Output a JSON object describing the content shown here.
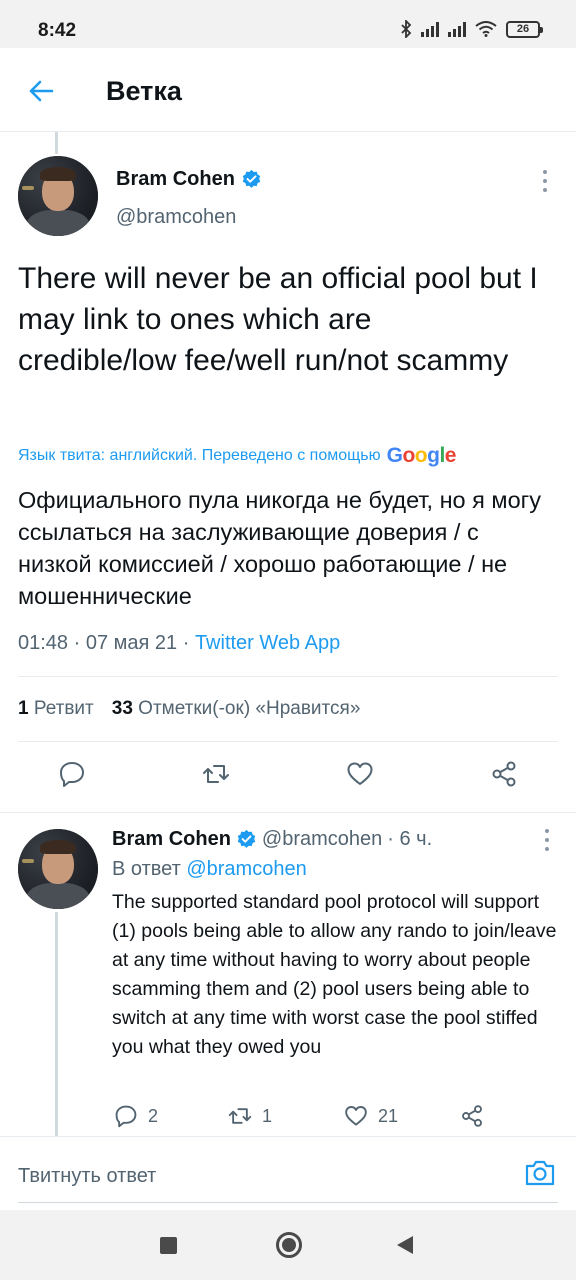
{
  "status_bar": {
    "time": "8:42",
    "battery": "26"
  },
  "header": {
    "title": "Ветка"
  },
  "main_tweet": {
    "author_name": "Bram Cohen",
    "author_handle": "@bramcohen",
    "text": "There will never be an official pool but I may link to ones which are credible/low fee/well run/not scammy",
    "translation_note": "Язык твита: английский. Переведено с помощью",
    "translator": "Google",
    "translated_text": "Официального пула никогда не будет, но я могу ссылаться на заслуживающие доверия / с низкой комиссией / хорошо работающие / не мошеннические",
    "time": "01:48",
    "date": "07 мая 21",
    "app": "Twitter Web App",
    "retweets_count": "1",
    "retweets_label": "Ретвит",
    "likes_count": "33",
    "likes_label": "Отметки(-ок) «Нравится»"
  },
  "reply_tweet": {
    "author_name": "Bram Cohen",
    "author_handle": "@bramcohen",
    "age": "· 6 ч.",
    "reply_prefix": "В ответ",
    "reply_to_handle": "@bramcohen",
    "text": "The supported standard pool protocol will support (1) pools being able to allow any rando to join/leave at any time without having to worry about people scamming them and (2) pool users being able to switch at any time with worst case the pool stiffed you what they owed you",
    "replies_count": "2",
    "retweets_count": "1",
    "likes_count": "21"
  },
  "compose": {
    "placeholder": "Твитнуть ответ"
  },
  "colors": {
    "accent": "#1d9bf0",
    "text": "#0f1419",
    "secondary": "#536471"
  }
}
